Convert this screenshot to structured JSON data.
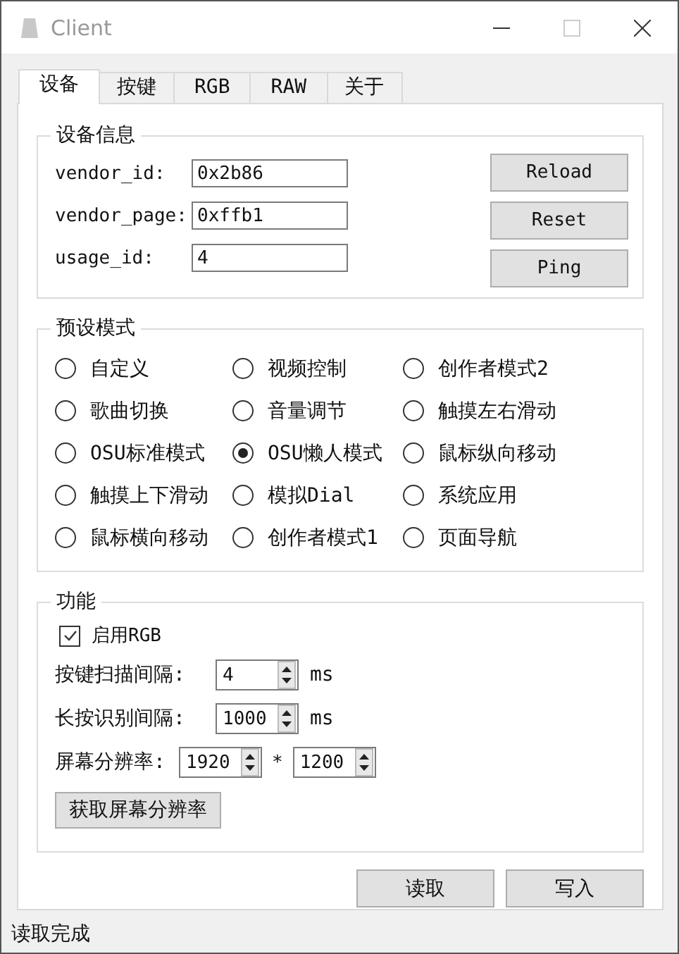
{
  "window": {
    "title": "Client"
  },
  "tabs": [
    {
      "label": "设备",
      "selected": true
    },
    {
      "label": "按键",
      "selected": false
    },
    {
      "label": "RGB",
      "selected": false
    },
    {
      "label": "RAW",
      "selected": false
    },
    {
      "label": "关于",
      "selected": false
    }
  ],
  "device_info": {
    "title": "设备信息",
    "fields": [
      {
        "label": "vendor_id:",
        "value": "0x2b86"
      },
      {
        "label": "vendor_page:",
        "value": "0xffb1"
      },
      {
        "label": "usage_id:",
        "value": "4"
      }
    ],
    "buttons": [
      "Reload",
      "Reset",
      "Ping"
    ]
  },
  "presets": {
    "title": "预设模式",
    "options": [
      {
        "label": "自定义",
        "selected": false
      },
      {
        "label": "视频控制",
        "selected": false
      },
      {
        "label": "创作者模式2",
        "selected": false
      },
      {
        "label": "歌曲切换",
        "selected": false
      },
      {
        "label": "音量调节",
        "selected": false
      },
      {
        "label": "触摸左右滑动",
        "selected": false
      },
      {
        "label": "OSU标准模式",
        "selected": false
      },
      {
        "label": "OSU懒人模式",
        "selected": true
      },
      {
        "label": "鼠标纵向移动",
        "selected": false
      },
      {
        "label": "触摸上下滑动",
        "selected": false
      },
      {
        "label": "模拟Dial",
        "selected": false
      },
      {
        "label": "系统应用",
        "selected": false
      },
      {
        "label": "鼠标横向移动",
        "selected": false
      },
      {
        "label": "创作者模式1",
        "selected": false
      },
      {
        "label": "页面导航",
        "selected": false
      }
    ]
  },
  "features": {
    "title": "功能",
    "checkbox": {
      "label": "启用RGB",
      "checked": true
    },
    "rows": [
      {
        "kind": "spin",
        "label": "按键扫描间隔:",
        "value": "4",
        "unit": "ms"
      },
      {
        "kind": "spin",
        "label": "长按识别间隔:",
        "value": "1000",
        "unit": "ms"
      },
      {
        "kind": "pair",
        "label": "屏幕分辨率:",
        "values": [
          "1920",
          "1200"
        ],
        "separator": "*"
      }
    ],
    "button": "获取屏幕分辨率"
  },
  "actions": [
    "读取",
    "写入"
  ],
  "status_bar": "读取完成"
}
